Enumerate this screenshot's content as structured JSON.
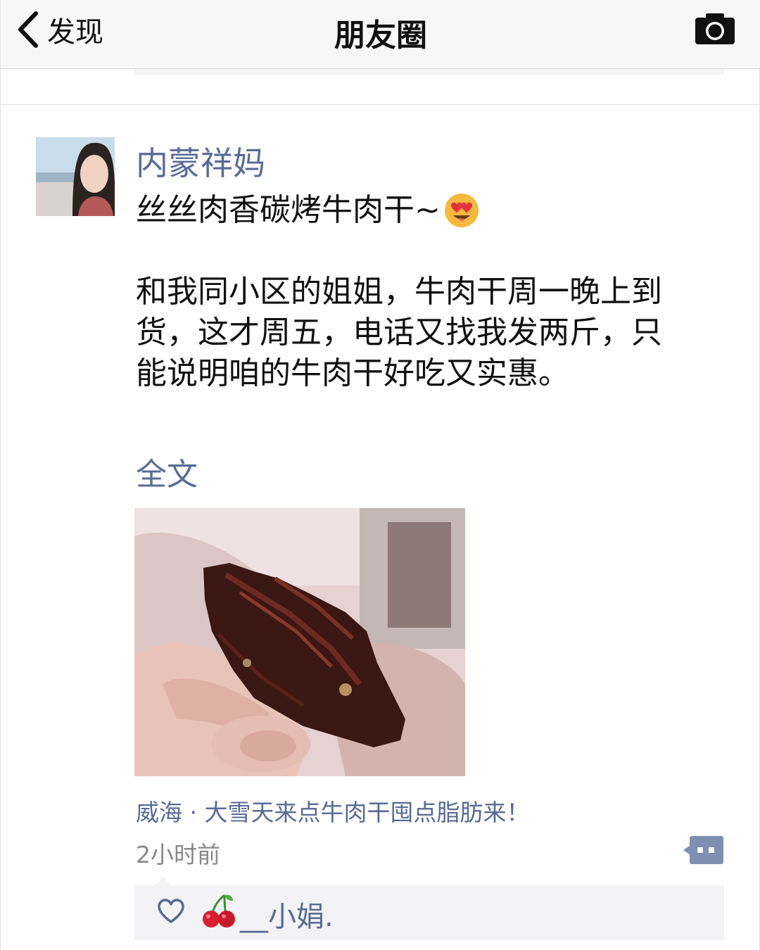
{
  "navbar": {
    "back_label": "发现",
    "title": "朋友圈"
  },
  "post": {
    "author": "内蒙祥妈",
    "text_line1": "丝丝肉香碳烤牛肉干~",
    "text_para2_line1": "和我同小区的姐姐，牛肉干周一晚上到",
    "text_para2_line2": "货，这才周五，电话又找我发两斤，只",
    "text_para2_line3": "能说明咱的牛肉干好吃又实惠。",
    "full_text_link": "全文",
    "location": "威海 · 大雪天来点牛肉干囤点脂肪来！",
    "time": "2小时前",
    "likes": [
      "__小娟."
    ]
  },
  "colors": {
    "link": "#576b95",
    "navbar_bg": "#f7f7f7",
    "comment_bg": "#f3f3f5",
    "time": "#888888"
  }
}
